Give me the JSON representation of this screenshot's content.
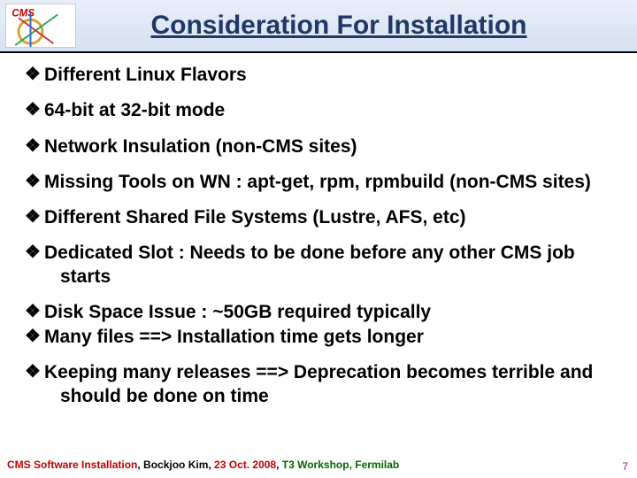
{
  "header": {
    "title": "Consideration For  Installation",
    "logo_label": "CMS"
  },
  "bullets": [
    {
      "text": "Different Linux Flavors",
      "tight": false
    },
    {
      "text": "64-bit at 32-bit mode",
      "tight": false
    },
    {
      "text": "Network Insulation (non-CMS sites)",
      "tight": false
    },
    {
      "text": "Missing Tools on WN : apt-get, rpm, rpmbuild (non-CMS sites)",
      "tight": false
    },
    {
      "text": "Different Shared File Systems (Lustre, AFS, etc)",
      "tight": false
    },
    {
      "text": "Dedicated Slot : Needs to be done before any other CMS job starts",
      "tight": false,
      "indent": true
    },
    {
      "text": "Disk Space Issue : ~50GB required typically",
      "tight": true
    },
    {
      "text": "Many files ==> Installation time gets longer",
      "tight": false
    },
    {
      "text": "Keeping many releases ==> Deprecation becomes terrible and should be done on time",
      "tight": false,
      "indent": true
    }
  ],
  "footer": {
    "part1": "CMS Software Installation",
    "part2": "Bockjoo Kim",
    "part3": "23 Oct. 2008",
    "part4": "T3 Workshop, Fermilab"
  },
  "page_number": "7"
}
